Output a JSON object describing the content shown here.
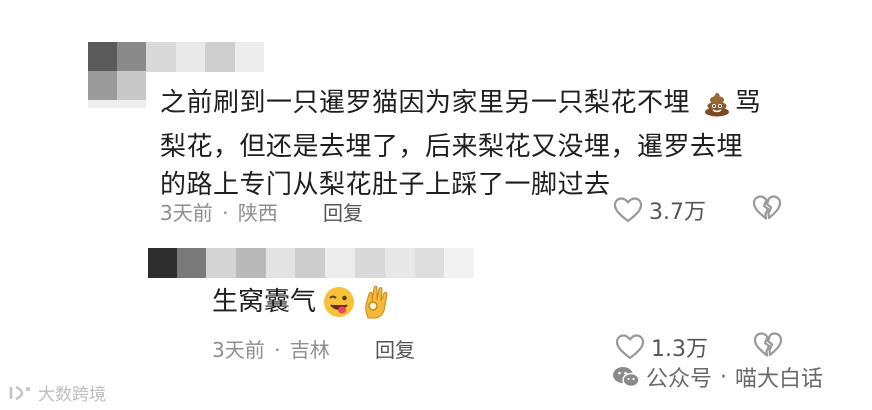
{
  "comment": {
    "text_lines": [
      "之前刷到一只暹罗猫因为家里另一只梨花不埋",
      "梨花，但还是去埋了，后来梨花又没埋，暹罗去埋",
      "的路上专门从梨花肚子上踩了一脚过去"
    ],
    "text_line1_tail": "骂",
    "time": "3天前",
    "location": "陕西",
    "separator": "·",
    "reply_label": "回复",
    "like_count": "3.7万"
  },
  "reply": {
    "text": "生窝囊气",
    "time": "3天前",
    "location": "吉林",
    "separator": "·",
    "reply_label": "回复",
    "like_count": "1.3万"
  },
  "watermarks": {
    "left": "大数跨境",
    "right_prefix": "公众号",
    "right_separator": "·",
    "right_name": "喵大白话"
  },
  "emoji": {
    "poop": "poop-emoji",
    "wink": "winking-tongue-emoji",
    "ok": "ok-hand-emoji"
  },
  "colors": {
    "text": "#1f1f1f",
    "meta": "#8e8e8e",
    "icon": "#999999"
  }
}
